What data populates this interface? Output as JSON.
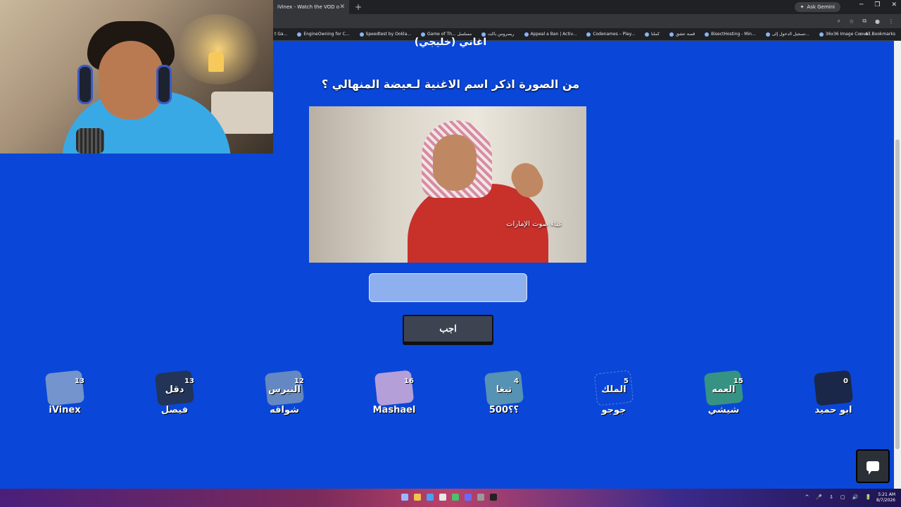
{
  "browser": {
    "tab_title": "iVinex - Watch the VOD on Kick",
    "tab_close": "✕",
    "new_tab": "+",
    "gemini_label": "Ask Gemini",
    "window_controls": [
      "─",
      "❐",
      "✕"
    ],
    "bookmarks": [
      "t Ga...",
      "EngineOwning for C...",
      "Speedtest by Ookla...",
      "Game of Th... مسلسل",
      "ربصروس باكت",
      "Appeal a Ban | Activ...",
      "Codenames – Play...",
      "كملنا",
      "قصة عشق",
      "BisectHosting - Min...",
      "تسجيل الدخول إلى...",
      "36x36 Image Conve..."
    ],
    "all_bookmarks": "All Bookmarks"
  },
  "quiz": {
    "category": "اغاني (خليجي)",
    "question": "من الصورة اذكر اسم الاغنية لـعيضة المنهالي ؟",
    "image_caption": "غناء صوت الإمارات",
    "answer_value": "",
    "submit_label": "اجب"
  },
  "players": [
    {
      "name": "iVinex",
      "score": "13",
      "avatar_text": ""
    },
    {
      "name": "فيصل",
      "score": "13",
      "avatar_text": "دقل"
    },
    {
      "name": "شواقه",
      "score": "12",
      "avatar_text": "النيرس"
    },
    {
      "name": "Mashael",
      "score": "16",
      "avatar_text": ""
    },
    {
      "name": "؟؟500",
      "score": "4",
      "avatar_text": "تبغا"
    },
    {
      "name": "جوجو",
      "score": "5",
      "avatar_text": "الملك"
    },
    {
      "name": "شيشي",
      "score": "15",
      "avatar_text": "العمه"
    },
    {
      "name": "ابو حميد",
      "score": "0",
      "avatar_text": ""
    }
  ],
  "taskbar": {
    "tray": [
      "^",
      "🎤",
      "⇩",
      "▢",
      "🔊",
      "🔋"
    ],
    "time": "5:21 AM",
    "date": "8/7/2026"
  },
  "colors": {
    "background": "#0a47d8",
    "input": "#8fb0ee",
    "button": "#3d4350"
  },
  "icons": {
    "chat": "chat-icon"
  }
}
